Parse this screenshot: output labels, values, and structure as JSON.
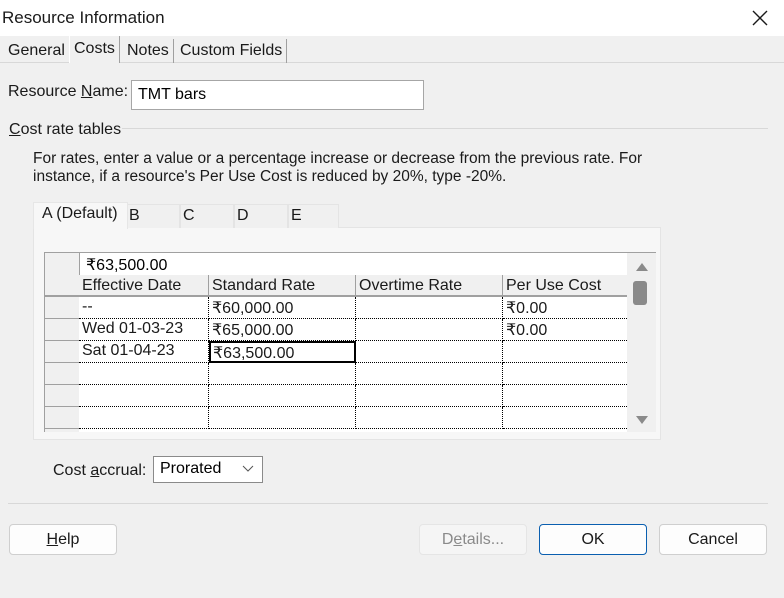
{
  "window": {
    "title": "Resource Information",
    "close_icon": "close-icon"
  },
  "tabs": [
    {
      "label": "General",
      "active": false
    },
    {
      "label": "Costs",
      "active": true
    },
    {
      "label": "Notes",
      "active": false
    },
    {
      "label": "Custom Fields",
      "active": false
    }
  ],
  "resource_name": {
    "label_pre": "Resource ",
    "label_accel": "N",
    "label_post": "ame:",
    "value": "TMT bars"
  },
  "cost_rate_tables": {
    "group_label_accel": "C",
    "group_label_rest": "ost rate tables",
    "description": "For rates, enter a value or a percentage increase or decrease from the previous rate. For instance, if a resource's Per Use Cost is reduced by 20%, type -20%.",
    "rate_tabs": [
      {
        "label": "A (Default)",
        "active": true
      },
      {
        "label": "B",
        "active": false
      },
      {
        "label": "C",
        "active": false
      },
      {
        "label": "D",
        "active": false
      },
      {
        "label": "E",
        "active": false
      }
    ],
    "edit_bar_value": "₹63,500.00",
    "columns": [
      "Effective Date",
      "Standard Rate",
      "Overtime Rate",
      "Per Use Cost"
    ],
    "rows": [
      [
        "--",
        "₹60,000.00",
        "",
        "₹0.00"
      ],
      [
        "Wed 01-03-23",
        "₹65,000.00",
        "",
        "₹0.00"
      ],
      [
        "Sat 01-04-23",
        "₹63,500.00",
        "",
        ""
      ],
      [
        "",
        "",
        "",
        ""
      ],
      [
        "",
        "",
        "",
        ""
      ],
      [
        "",
        "",
        "",
        ""
      ]
    ],
    "selected_cell": {
      "row": 2,
      "column": "Standard Rate"
    }
  },
  "cost_accrual": {
    "label_pre": "Cost ",
    "label_accel": "a",
    "label_post": "ccrual:",
    "value": "Prorated"
  },
  "buttons": {
    "help_accel": "H",
    "help_rest": "elp",
    "details_pre": "D",
    "details_accel": "e",
    "details_post": "tails...",
    "ok": "OK",
    "cancel": "Cancel"
  }
}
